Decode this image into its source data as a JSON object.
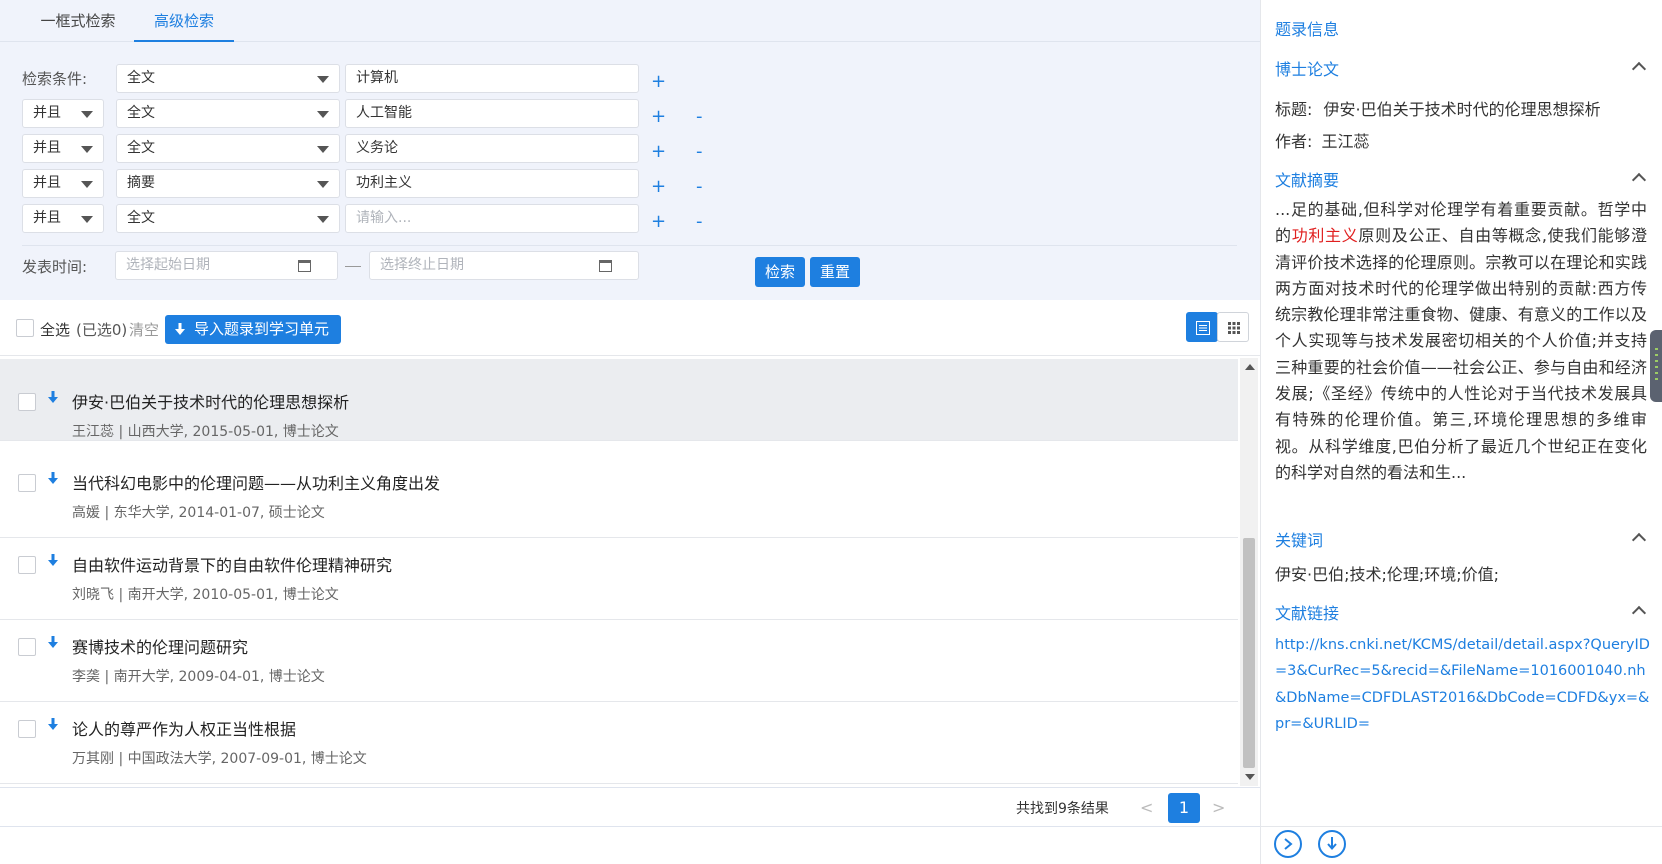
{
  "tabs": [
    "一框式检索",
    "高级检索"
  ],
  "active_tab": 1,
  "search": {
    "label": "检索条件:",
    "rows": [
      {
        "logic": "",
        "field": "全文",
        "value": "计算机",
        "placeholder": ""
      },
      {
        "logic": "并且",
        "field": "全文",
        "value": "人工智能",
        "placeholder": ""
      },
      {
        "logic": "并且",
        "field": "全文",
        "value": "义务论",
        "placeholder": ""
      },
      {
        "logic": "并且",
        "field": "摘要",
        "value": "功利主义",
        "placeholder": ""
      },
      {
        "logic": "并且",
        "field": "全文",
        "value": "",
        "placeholder": "请输入..."
      }
    ],
    "plus": "+",
    "minus": "-",
    "date_label": "发表时间:",
    "date_start_placeholder": "选择起始日期",
    "date_end_placeholder": "选择终止日期",
    "search_button": "检索",
    "reset_button": "重置"
  },
  "toolbar": {
    "select_all": "全选",
    "selected_count": "(已选0)",
    "clear": "清空",
    "import_button": "导入题录到学习单元"
  },
  "results": [
    {
      "title": "伊安·巴伯关于技术时代的伦理思想探析",
      "meta": "王江蕊 | 山西大学, 2015-05-01, 博士论文",
      "selected": true
    },
    {
      "title": "当代科幻电影中的伦理问题——从功利主义角度出发",
      "meta": "高媛 | 东华大学, 2014-01-07, 硕士论文",
      "selected": false
    },
    {
      "title": "自由软件运动背景下的自由软件伦理精神研究",
      "meta": "刘晓飞 | 南开大学, 2010-05-01, 博士论文",
      "selected": false
    },
    {
      "title": "赛博技术的伦理问题研究",
      "meta": "李䶮 | 南开大学, 2009-04-01, 博士论文",
      "selected": false
    },
    {
      "title": "论人的尊严作为人权正当性根据",
      "meta": "万其刚 | 中国政法大学, 2007-09-01, 博士论文",
      "selected": false
    }
  ],
  "pagination": {
    "total_text": "共找到9条结果",
    "prev": "<",
    "current_page": "1",
    "next": ">"
  },
  "detail": {
    "header": "题录信息",
    "type": "博士论文",
    "title_label": "标题:",
    "title": "伊安·巴伯关于技术时代的伦理思想探析",
    "author_label": "作者:",
    "author": "王江蕊",
    "abstract_header": "文献摘要",
    "abstract_before": "...足的基础,但科学对伦理学有着重要贡献。哲学中的",
    "abstract_highlight": "功利主义",
    "abstract_after": "原则及公正、自由等概念,使我们能够澄清评价技术选择的伦理原则。宗教可以在理论和实践两方面对技术时代的伦理学做出特别的贡献:西方传统宗教伦理非常注重食物、健康、有意义的工作以及个人实现等与技术发展密切相关的个人价值;并支持三种重要的社会价值——社会公正、参与自由和经济发展;《圣经》传统中的人性论对于当代技术发展具有特殊的伦理价值。第三,环境伦理思想的多维审视。从科学维度,巴伯分析了最近几个世纪正在变化的科学对自然的看法和生...",
    "keywords_header": "关键词",
    "keywords": "伊安·巴伯;技术;伦理;环境;价值;",
    "link_header": "文献链接",
    "link": "http://kns.cnki.net/KCMS/detail/detail.aspx?QueryID=3&CurRec=5&recid=&FileName=1016001040.nh&DbName=CDFDLAST2016&DbCode=CDFD&yx=&pr=&URLID="
  },
  "colors": {
    "accent": "#1e7fe0",
    "highlight": "#e02020",
    "search_bg": "#f0f3fb",
    "selected_row": "#ebedf0"
  }
}
